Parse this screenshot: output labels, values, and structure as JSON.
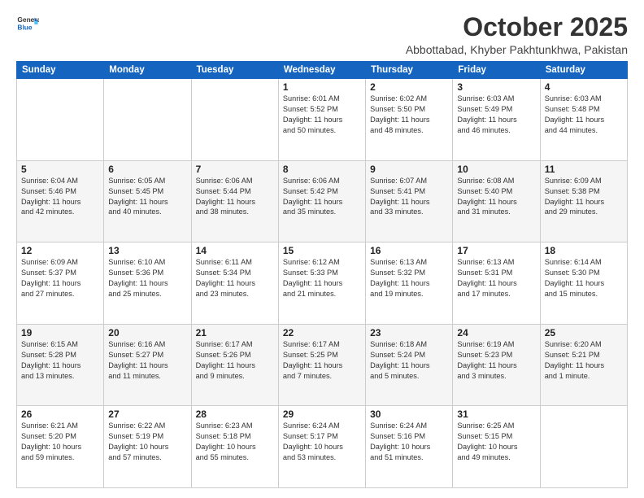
{
  "logo": {
    "general": "General",
    "blue": "Blue"
  },
  "title": "October 2025",
  "subtitle": "Abbottabad, Khyber Pakhtunkhwa, Pakistan",
  "weekdays": [
    "Sunday",
    "Monday",
    "Tuesday",
    "Wednesday",
    "Thursday",
    "Friday",
    "Saturday"
  ],
  "weeks": [
    [
      {
        "day": "",
        "info": ""
      },
      {
        "day": "",
        "info": ""
      },
      {
        "day": "",
        "info": ""
      },
      {
        "day": "1",
        "info": "Sunrise: 6:01 AM\nSunset: 5:52 PM\nDaylight: 11 hours\nand 50 minutes."
      },
      {
        "day": "2",
        "info": "Sunrise: 6:02 AM\nSunset: 5:50 PM\nDaylight: 11 hours\nand 48 minutes."
      },
      {
        "day": "3",
        "info": "Sunrise: 6:03 AM\nSunset: 5:49 PM\nDaylight: 11 hours\nand 46 minutes."
      },
      {
        "day": "4",
        "info": "Sunrise: 6:03 AM\nSunset: 5:48 PM\nDaylight: 11 hours\nand 44 minutes."
      }
    ],
    [
      {
        "day": "5",
        "info": "Sunrise: 6:04 AM\nSunset: 5:46 PM\nDaylight: 11 hours\nand 42 minutes."
      },
      {
        "day": "6",
        "info": "Sunrise: 6:05 AM\nSunset: 5:45 PM\nDaylight: 11 hours\nand 40 minutes."
      },
      {
        "day": "7",
        "info": "Sunrise: 6:06 AM\nSunset: 5:44 PM\nDaylight: 11 hours\nand 38 minutes."
      },
      {
        "day": "8",
        "info": "Sunrise: 6:06 AM\nSunset: 5:42 PM\nDaylight: 11 hours\nand 35 minutes."
      },
      {
        "day": "9",
        "info": "Sunrise: 6:07 AM\nSunset: 5:41 PM\nDaylight: 11 hours\nand 33 minutes."
      },
      {
        "day": "10",
        "info": "Sunrise: 6:08 AM\nSunset: 5:40 PM\nDaylight: 11 hours\nand 31 minutes."
      },
      {
        "day": "11",
        "info": "Sunrise: 6:09 AM\nSunset: 5:38 PM\nDaylight: 11 hours\nand 29 minutes."
      }
    ],
    [
      {
        "day": "12",
        "info": "Sunrise: 6:09 AM\nSunset: 5:37 PM\nDaylight: 11 hours\nand 27 minutes."
      },
      {
        "day": "13",
        "info": "Sunrise: 6:10 AM\nSunset: 5:36 PM\nDaylight: 11 hours\nand 25 minutes."
      },
      {
        "day": "14",
        "info": "Sunrise: 6:11 AM\nSunset: 5:34 PM\nDaylight: 11 hours\nand 23 minutes."
      },
      {
        "day": "15",
        "info": "Sunrise: 6:12 AM\nSunset: 5:33 PM\nDaylight: 11 hours\nand 21 minutes."
      },
      {
        "day": "16",
        "info": "Sunrise: 6:13 AM\nSunset: 5:32 PM\nDaylight: 11 hours\nand 19 minutes."
      },
      {
        "day": "17",
        "info": "Sunrise: 6:13 AM\nSunset: 5:31 PM\nDaylight: 11 hours\nand 17 minutes."
      },
      {
        "day": "18",
        "info": "Sunrise: 6:14 AM\nSunset: 5:30 PM\nDaylight: 11 hours\nand 15 minutes."
      }
    ],
    [
      {
        "day": "19",
        "info": "Sunrise: 6:15 AM\nSunset: 5:28 PM\nDaylight: 11 hours\nand 13 minutes."
      },
      {
        "day": "20",
        "info": "Sunrise: 6:16 AM\nSunset: 5:27 PM\nDaylight: 11 hours\nand 11 minutes."
      },
      {
        "day": "21",
        "info": "Sunrise: 6:17 AM\nSunset: 5:26 PM\nDaylight: 11 hours\nand 9 minutes."
      },
      {
        "day": "22",
        "info": "Sunrise: 6:17 AM\nSunset: 5:25 PM\nDaylight: 11 hours\nand 7 minutes."
      },
      {
        "day": "23",
        "info": "Sunrise: 6:18 AM\nSunset: 5:24 PM\nDaylight: 11 hours\nand 5 minutes."
      },
      {
        "day": "24",
        "info": "Sunrise: 6:19 AM\nSunset: 5:23 PM\nDaylight: 11 hours\nand 3 minutes."
      },
      {
        "day": "25",
        "info": "Sunrise: 6:20 AM\nSunset: 5:21 PM\nDaylight: 11 hours\nand 1 minute."
      }
    ],
    [
      {
        "day": "26",
        "info": "Sunrise: 6:21 AM\nSunset: 5:20 PM\nDaylight: 10 hours\nand 59 minutes."
      },
      {
        "day": "27",
        "info": "Sunrise: 6:22 AM\nSunset: 5:19 PM\nDaylight: 10 hours\nand 57 minutes."
      },
      {
        "day": "28",
        "info": "Sunrise: 6:23 AM\nSunset: 5:18 PM\nDaylight: 10 hours\nand 55 minutes."
      },
      {
        "day": "29",
        "info": "Sunrise: 6:24 AM\nSunset: 5:17 PM\nDaylight: 10 hours\nand 53 minutes."
      },
      {
        "day": "30",
        "info": "Sunrise: 6:24 AM\nSunset: 5:16 PM\nDaylight: 10 hours\nand 51 minutes."
      },
      {
        "day": "31",
        "info": "Sunrise: 6:25 AM\nSunset: 5:15 PM\nDaylight: 10 hours\nand 49 minutes."
      },
      {
        "day": "",
        "info": ""
      }
    ]
  ]
}
